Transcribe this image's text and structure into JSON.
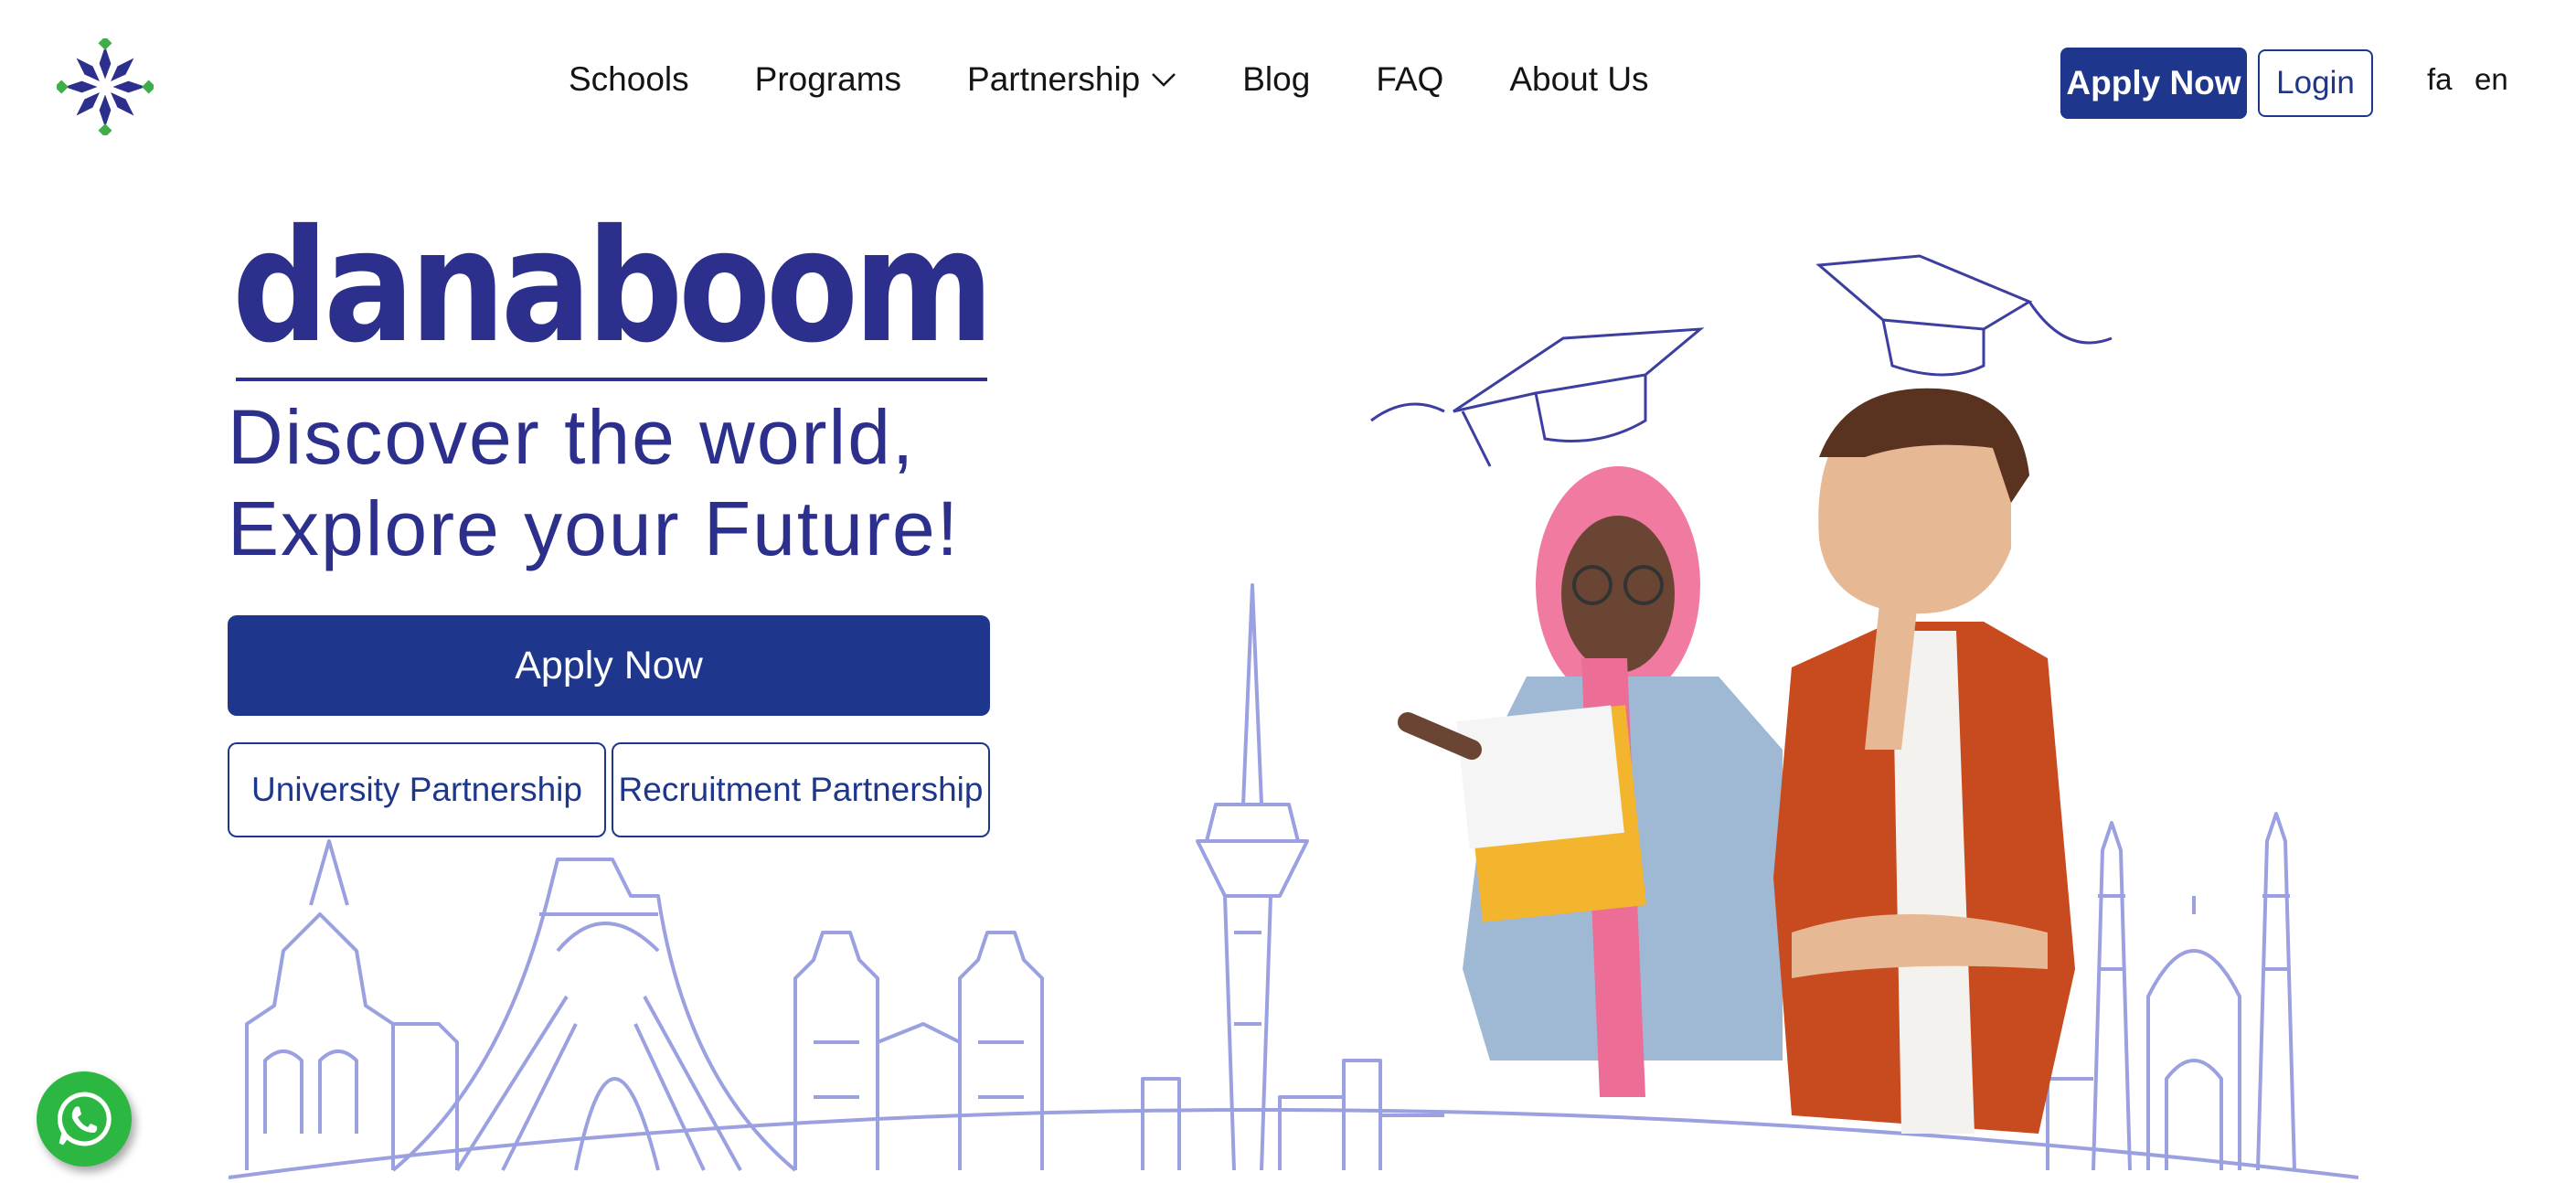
{
  "header": {
    "logo_icon": "flower-logo-icon",
    "nav": [
      "Schools",
      "Programs",
      "Partnership",
      "Blog",
      "FAQ",
      "About Us"
    ],
    "apply_label": "Apply Now",
    "login_label": "Login",
    "lang_fa": "fa",
    "lang_en": "en"
  },
  "hero": {
    "brand": "danaboom",
    "headline_line1": "Discover the world,",
    "headline_line2": "Explore your Future!",
    "apply_label": "Apply Now",
    "university_partnership": "University Partnership",
    "recruitment_partnership": "Recruitment Partnership"
  },
  "floating": {
    "whatsapp_icon": "whatsapp-icon"
  },
  "colors": {
    "brand_blue": "#1e378c",
    "headline": "#2c2f8c",
    "skyline": "#9aa0e0",
    "whatsapp": "#2bb741",
    "logo_green": "#3fae49"
  }
}
